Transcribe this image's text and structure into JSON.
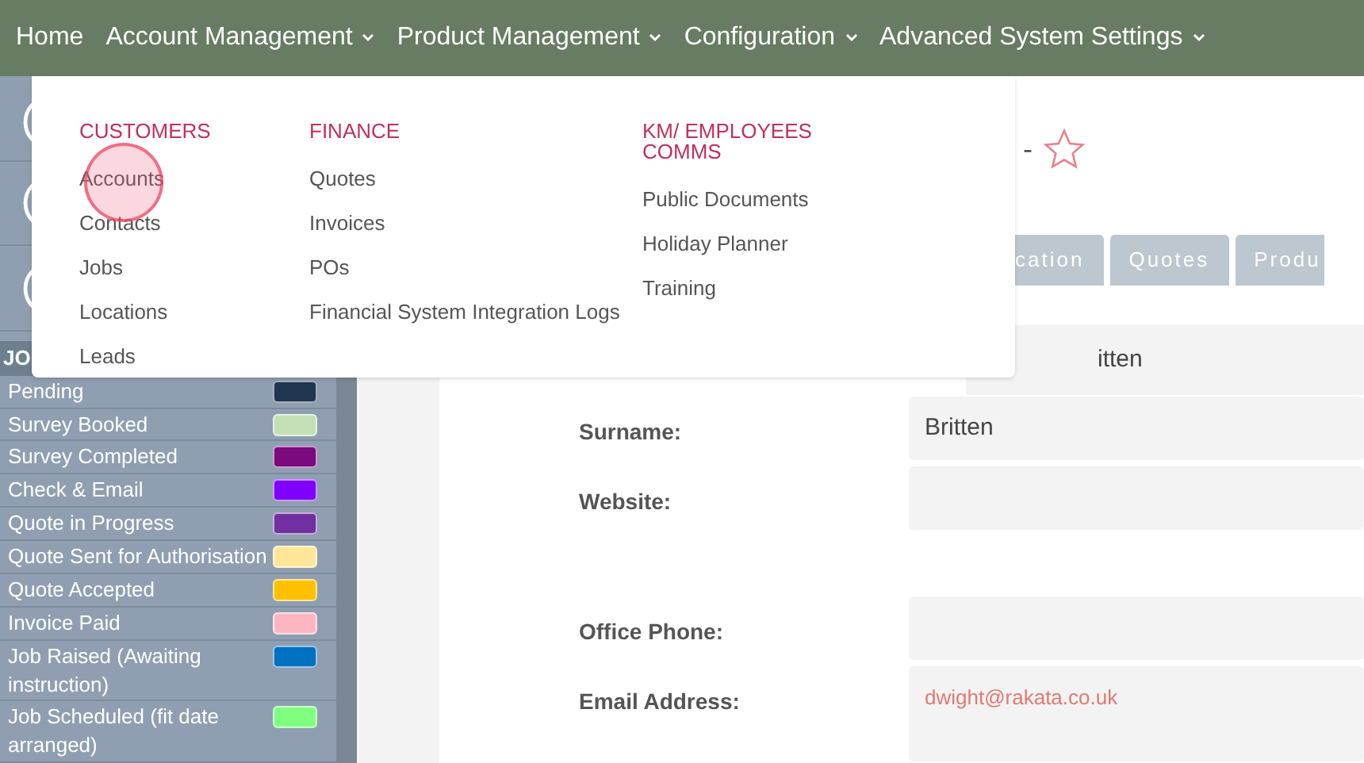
{
  "nav": [
    {
      "label": "Home",
      "dropdown": false
    },
    {
      "label": "Account Management",
      "dropdown": true
    },
    {
      "label": "Product Management",
      "dropdown": true
    },
    {
      "label": "Configuration",
      "dropdown": true
    },
    {
      "label": "Advanced System Settings",
      "dropdown": true
    }
  ],
  "menu": {
    "columns": [
      {
        "heading": "CUSTOMERS",
        "items": [
          "Accounts",
          "Contacts",
          "Jobs",
          "Locations",
          "Leads"
        ]
      },
      {
        "heading": "FINANCE",
        "items": [
          "Quotes",
          "Invoices",
          "POs",
          "Financial System Integration Logs"
        ]
      },
      {
        "heading": "KM/ EMPLOYEES COMMS",
        "items": [
          "Public Documents",
          "Holiday Planner",
          "Training"
        ]
      }
    ]
  },
  "sidebar": {
    "header": "JO",
    "statuses": [
      {
        "label": "Pending",
        "color": "#1f3550"
      },
      {
        "label": "Survey Booked",
        "color": "#c5dfb4"
      },
      {
        "label": "Survey Completed",
        "color": "#7b0a7e"
      },
      {
        "label": "Check & Email",
        "color": "#7f00ff"
      },
      {
        "label": "Quote in Progress",
        "color": "#7030a0"
      },
      {
        "label": "Quote Sent for Authorisation",
        "color": "#ffe699"
      },
      {
        "label": "Quote Accepted",
        "color": "#ffc000"
      },
      {
        "label": "Invoice Paid",
        "color": "#ffb6c1"
      },
      {
        "label": "Job Raised (Awaiting instruction)",
        "color": "#0070c0"
      },
      {
        "label": "Job Scheduled (fit date arranged)",
        "color": "#80ff80"
      }
    ]
  },
  "record": {
    "title_tail": "-",
    "tabs": [
      "cation",
      "Quotes",
      "Produ"
    ],
    "first_value": "itten",
    "fields": [
      {
        "label": "Surname:",
        "value": "Britten",
        "kind": "text"
      },
      {
        "label": "Website:",
        "kind": "text"
      },
      {
        "kind": "gap"
      },
      {
        "label": "Office Phone:",
        "kind": "text"
      },
      {
        "label": "Email Address:",
        "value": "dwight@rakata.co.uk",
        "kind": "email"
      }
    ]
  }
}
